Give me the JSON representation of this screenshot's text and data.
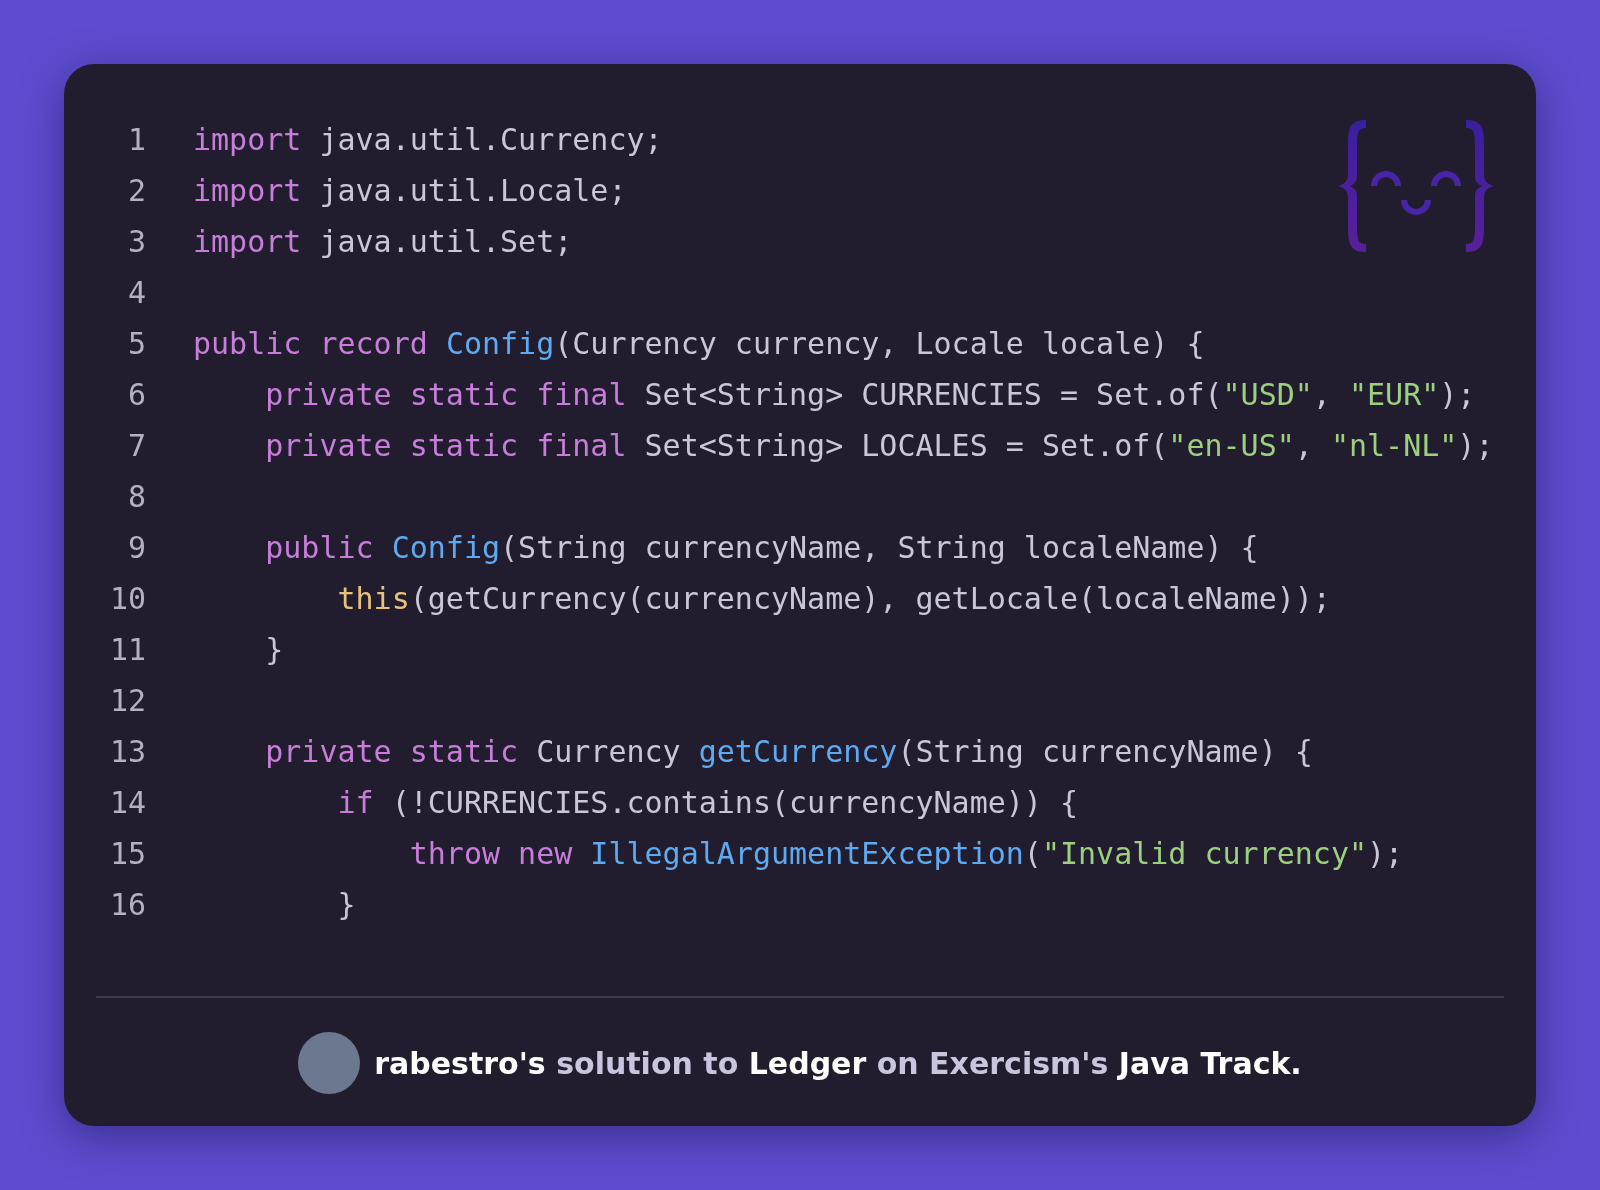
{
  "code": {
    "lines": [
      {
        "number": "1",
        "tokens": [
          {
            "kind": "keyword",
            "text": "import"
          },
          {
            "kind": "plain",
            "text": " java.util.Currency;"
          }
        ]
      },
      {
        "number": "2",
        "tokens": [
          {
            "kind": "keyword",
            "text": "import"
          },
          {
            "kind": "plain",
            "text": " java.util.Locale;"
          }
        ]
      },
      {
        "number": "3",
        "tokens": [
          {
            "kind": "keyword",
            "text": "import"
          },
          {
            "kind": "plain",
            "text": " java.util.Set;"
          }
        ]
      },
      {
        "number": "4"
      },
      {
        "number": "5",
        "tokens": [
          {
            "kind": "keyword",
            "text": "public record "
          },
          {
            "kind": "function",
            "text": "Config"
          },
          {
            "kind": "plain",
            "text": "(Currency currency, Locale locale) {"
          }
        ]
      },
      {
        "number": "6",
        "tokens": [
          {
            "kind": "keyword",
            "text": "    private static final"
          },
          {
            "kind": "plain",
            "text": " Set<String> CURRENCIES = Set.of("
          },
          {
            "kind": "string",
            "text": "\"USD\""
          },
          {
            "kind": "plain",
            "text": ", "
          },
          {
            "kind": "string",
            "text": "\"EUR\""
          },
          {
            "kind": "plain",
            "text": ");"
          }
        ]
      },
      {
        "number": "7",
        "tokens": [
          {
            "kind": "keyword",
            "text": "    private static final"
          },
          {
            "kind": "plain",
            "text": " Set<String> LOCALES = Set.of("
          },
          {
            "kind": "string",
            "text": "\"en-US\""
          },
          {
            "kind": "plain",
            "text": ", "
          },
          {
            "kind": "string",
            "text": "\"nl-NL\""
          },
          {
            "kind": "plain",
            "text": ");"
          }
        ]
      },
      {
        "number": "8"
      },
      {
        "number": "9",
        "tokens": [
          {
            "kind": "keyword",
            "text": "    public "
          },
          {
            "kind": "function",
            "text": "Config"
          },
          {
            "kind": "plain",
            "text": "(String currencyName, String localeName) {"
          }
        ]
      },
      {
        "number": "10",
        "tokens": [
          {
            "kind": "this",
            "text": "        this"
          },
          {
            "kind": "plain",
            "text": "(getCurrency(currencyName), getLocale(localeName));"
          }
        ]
      },
      {
        "number": "11",
        "tokens": [
          {
            "kind": "plain",
            "text": "    }"
          }
        ]
      },
      {
        "number": "12"
      },
      {
        "number": "13",
        "tokens": [
          {
            "kind": "keyword",
            "text": "    private static"
          },
          {
            "kind": "plain",
            "text": " Currency "
          },
          {
            "kind": "function",
            "text": "getCurrency"
          },
          {
            "kind": "plain",
            "text": "(String currencyName) {"
          }
        ]
      },
      {
        "number": "14",
        "tokens": [
          {
            "kind": "keyword",
            "text": "        if"
          },
          {
            "kind": "plain",
            "text": " (!CURRENCIES.contains(currencyName)) {"
          }
        ]
      },
      {
        "number": "15",
        "tokens": [
          {
            "kind": "keyword",
            "text": "            throw new "
          },
          {
            "kind": "function",
            "text": "IllegalArgumentException"
          },
          {
            "kind": "plain",
            "text": "("
          },
          {
            "kind": "string",
            "text": "\"Invalid currency\""
          },
          {
            "kind": "plain",
            "text": ");"
          }
        ]
      },
      {
        "number": "16",
        "tokens": [
          {
            "kind": "plain",
            "text": "        }"
          }
        ]
      }
    ]
  },
  "footer": {
    "caption": "**rabestro's** solution to **Ledger** on Exercism's **Java Track.**"
  }
}
